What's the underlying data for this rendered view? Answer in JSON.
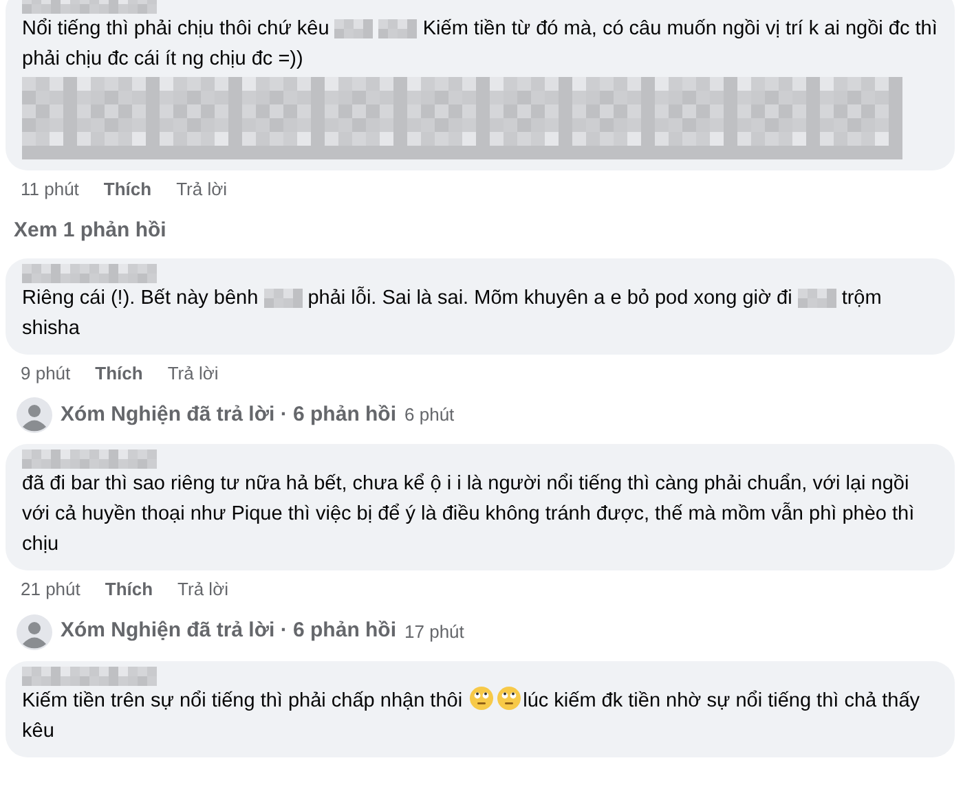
{
  "comments": [
    {
      "segments": [
        {
          "kind": "text",
          "text": "Nổi tiếng thì phải chịu thôi chứ kêu"
        },
        {
          "kind": "blur"
        },
        {
          "kind": "blur"
        },
        {
          "kind": "text",
          "text": "Kiếm tiền từ đó mà, có câu muốn ngồi vị trí k ai ngồi đc thì phải chịu đc cái ít ng chịu đc =))"
        },
        {
          "kind": "blur_block"
        }
      ],
      "time": "11 phút",
      "like": "Thích",
      "reply": "Trả lời",
      "more": {
        "kind": "link",
        "text": "Xem 1 phản hồi"
      }
    },
    {
      "segments": [
        {
          "kind": "text",
          "text": "Riêng cái (!). Bết này bênh"
        },
        {
          "kind": "blur"
        },
        {
          "kind": "text",
          "text": "phải lỗi. Sai là sai. Mõm khuyên a e bỏ pod xong giờ đi"
        },
        {
          "kind": "blur"
        },
        {
          "kind": "text",
          "text": "trộm shisha"
        }
      ],
      "time": "9 phút",
      "like": "Thích",
      "reply": "Trả lời",
      "more": {
        "kind": "summary",
        "text": "Xóm Nghiện đã trả lời · 6 phản hồi",
        "time": "6 phút"
      }
    },
    {
      "segments": [
        {
          "kind": "text",
          "text": "đã đi bar thì sao riêng tư nữa hả bết, chưa kể ộ i i là người nổi tiếng thì càng phải chuẩn, với lại ngồi với cả huyền thoại như Pique thì việc bị để ý là điều không tránh được, thế mà mồm vẫn phì phèo thì chịu"
        }
      ],
      "time": "21 phút",
      "like": "Thích",
      "reply": "Trả lời",
      "more": {
        "kind": "summary",
        "text": "Xóm Nghiện đã trả lời · 6 phản hồi",
        "time": "17 phút"
      }
    },
    {
      "segments": [
        {
          "kind": "text",
          "text": "Kiếm tiền trên sự nổi tiếng thì phải chấp nhận thôi"
        },
        {
          "kind": "emoji"
        },
        {
          "kind": "emoji"
        },
        {
          "kind": "text",
          "text": "lúc kiếm đk tiền nhờ sự nổi tiếng thì chả thấy kêu"
        }
      ]
    }
  ]
}
